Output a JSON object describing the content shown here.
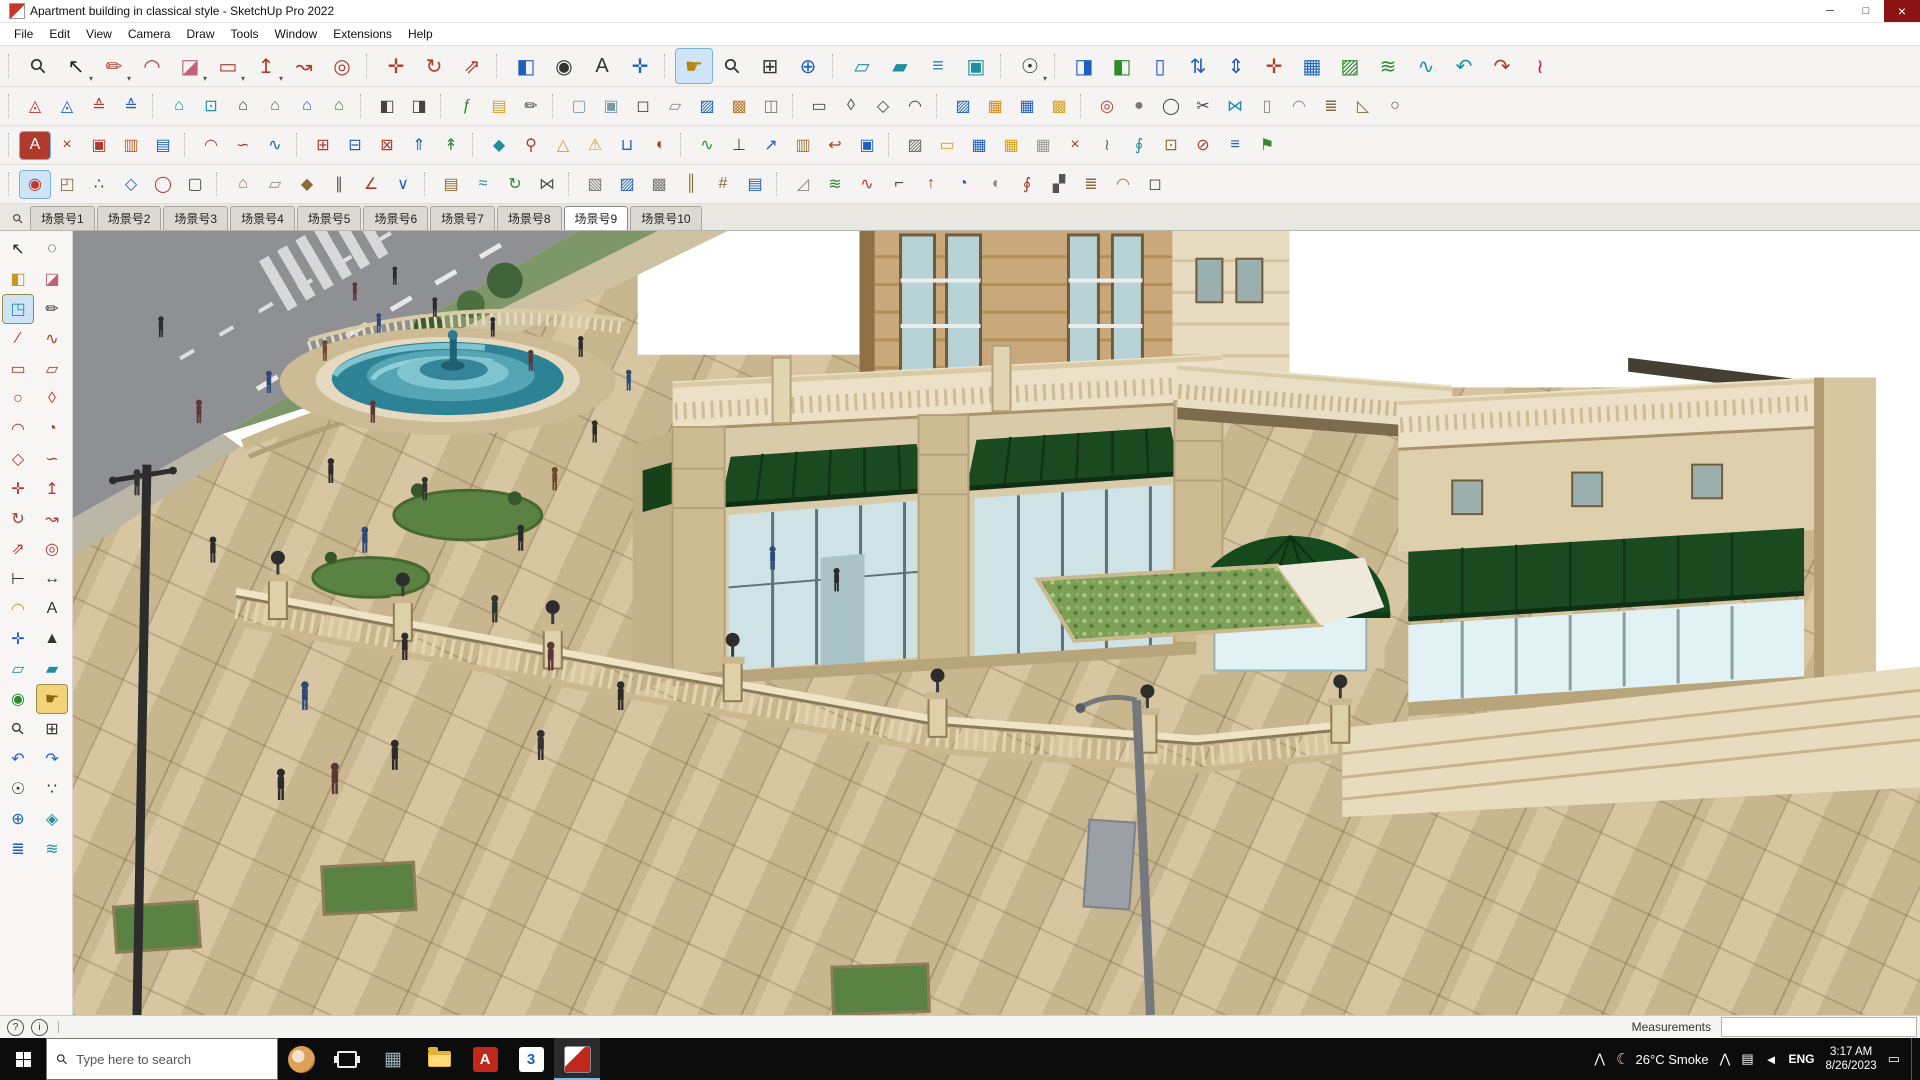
{
  "window": {
    "title": "Apartment building in classical style - SketchUp Pro 2022",
    "min_glyph": "─",
    "max_glyph": "□",
    "close_glyph": "×"
  },
  "ui": {
    "caret": "▾",
    "search_glyph": "⚲"
  },
  "menu": {
    "items": [
      "File",
      "Edit",
      "View",
      "Camera",
      "Draw",
      "Tools",
      "Window",
      "Extensions",
      "Help"
    ]
  },
  "toolbars": {
    "row1": [
      {
        "sep": true
      },
      {
        "n": "search-tool",
        "g": "⚲",
        "c": "#333",
        "rot": true
      },
      {
        "n": "select-tool",
        "g": "↖",
        "c": "#222",
        "dd": true
      },
      {
        "n": "line-tool",
        "g": "✏",
        "c": "#b03a2e",
        "dd": true
      },
      {
        "n": "arc-tool",
        "g": "◠",
        "c": "#b03a2e"
      },
      {
        "n": "eraser-tool",
        "g": "◪",
        "c": "#c0607a",
        "dd": true
      },
      {
        "n": "rectangle-tool",
        "g": "▭",
        "c": "#b03a2e",
        "dd": true
      },
      {
        "n": "push-pull-tool",
        "g": "↥",
        "c": "#b03a2e",
        "dd": true
      },
      {
        "n": "follow-me-tool",
        "g": "↝",
        "c": "#b03a2e"
      },
      {
        "n": "offset-tool",
        "g": "◎",
        "c": "#b03a2e"
      },
      {
        "sep": true
      },
      {
        "n": "move-tool",
        "g": "✛",
        "c": "#b03a2e"
      },
      {
        "n": "rotate-tool",
        "g": "↻",
        "c": "#b03a2e"
      },
      {
        "n": "scale-tool",
        "g": "⇗",
        "c": "#b03a2e"
      },
      {
        "sep": true
      },
      {
        "n": "paint-bucket-tool",
        "g": "◧",
        "c": "#1f5fbf"
      },
      {
        "n": "look-around-tool",
        "g": "◉",
        "c": "#333"
      },
      {
        "n": "text-tool",
        "g": "A",
        "c": "#333"
      },
      {
        "n": "axes-tool",
        "g": "✛",
        "c": "#1f5fbf"
      },
      {
        "sep": true
      },
      {
        "n": "pan-tool",
        "g": "☛",
        "c": "#b8860b",
        "hl": true
      },
      {
        "n": "zoom-tool",
        "g": "⚲",
        "c": "#333",
        "rot": true
      },
      {
        "n": "zoom-window-tool",
        "g": "⊞",
        "c": "#333"
      },
      {
        "n": "orbit-tool",
        "g": "⊕",
        "c": "#1f5fbf"
      },
      {
        "sep": true
      },
      {
        "n": "section-plane-tool",
        "g": "▱",
        "c": "#1f8fa0"
      },
      {
        "n": "section-fill-tool",
        "g": "▰",
        "c": "#1f8fa0"
      },
      {
        "n": "section-display-tool",
        "g": "≡",
        "c": "#1f8fa0"
      },
      {
        "n": "scene-manager-tool",
        "g": "▣",
        "c": "#1f8fa0"
      },
      {
        "sep": true
      },
      {
        "n": "camera-menu-tool",
        "g": "☉",
        "c": "#333",
        "dd": true
      },
      {
        "sep": true
      },
      {
        "n": "paint-all-tool",
        "g": "◨",
        "c": "#1f5fbf"
      },
      {
        "n": "sample-material-tool",
        "g": "◧",
        "c": "#2e8b2e"
      },
      {
        "n": "vertical-ruler-tool",
        "g": "▯",
        "c": "#1f5fbf"
      },
      {
        "n": "sort-ascending-tool",
        "g": "⇅",
        "c": "#1f5fbf"
      },
      {
        "n": "sort-descending-tool",
        "g": "⇕",
        "c": "#1f5fbf"
      },
      {
        "n": "cross-axes-tool",
        "g": "✛",
        "c": "#b03a2e"
      },
      {
        "n": "grid-tool",
        "g": "▦",
        "c": "#1f5fbf"
      },
      {
        "n": "uv-mapping-tool",
        "g": "▨",
        "c": "#2e8b2e"
      },
      {
        "n": "contour-tool",
        "g": "≋",
        "c": "#2e8b2e"
      },
      {
        "n": "weld-tool",
        "g": "∿",
        "c": "#1f8fa0"
      },
      {
        "n": "curve-undo-tool",
        "g": "↶",
        "c": "#1f8fa0"
      },
      {
        "n": "curve-redo-tool",
        "g": "↷",
        "c": "#b03a2e"
      },
      {
        "n": "curl-tool",
        "g": "≀",
        "c": "#c2185b"
      }
    ],
    "row2": [
      {
        "sep": true
      },
      {
        "n": "triangle-red-tool",
        "g": "◬",
        "c": "#b03a2e"
      },
      {
        "n": "triangle-blue-tool",
        "g": "◬",
        "c": "#1f5fbf"
      },
      {
        "n": "stack-red-tool",
        "g": "≙",
        "c": "#b03a2e"
      },
      {
        "n": "stack-blue-tool",
        "g": "≙",
        "c": "#1f5fbf"
      },
      {
        "sep": true
      },
      {
        "n": "iso-view",
        "g": "⌂",
        "c": "#1f8fa0"
      },
      {
        "n": "top-view",
        "g": "⊡",
        "c": "#1f8fa0"
      },
      {
        "n": "front-view",
        "g": "⌂",
        "c": "#444"
      },
      {
        "n": "back-view",
        "g": "⌂",
        "c": "#666"
      },
      {
        "n": "left-view",
        "g": "⌂",
        "c": "#1f5fbf"
      },
      {
        "n": "right-view",
        "g": "⌂",
        "c": "#2e8b2e"
      },
      {
        "sep": true
      },
      {
        "n": "perspective-toggle",
        "g": "◧",
        "c": "#444"
      },
      {
        "n": "two-point-perspective",
        "g": "◨",
        "c": "#444"
      },
      {
        "sep": true
      },
      {
        "n": "fredo-tools",
        "g": "ƒ",
        "c": "#2e8b2e"
      },
      {
        "n": "note-tool",
        "g": "▤",
        "c": "#d9a21a"
      },
      {
        "n": "sketch-pencil",
        "g": "✏",
        "c": "#444"
      },
      {
        "sep": true
      },
      {
        "n": "xray-mode",
        "g": "▢",
        "c": "#7a9aa8"
      },
      {
        "n": "back-edges-mode",
        "g": "▣",
        "c": "#7a9aa8"
      },
      {
        "n": "wireframe-mode",
        "g": "◻",
        "c": "#444"
      },
      {
        "n": "hidden-line-mode",
        "g": "▱",
        "c": "#888"
      },
      {
        "n": "shaded-mode",
        "g": "▨",
        "c": "#1f5fbf"
      },
      {
        "n": "textured-mode",
        "g": "▩",
        "c": "#b9792e"
      },
      {
        "n": "monochrome-mode",
        "g": "◫",
        "c": "#777"
      },
      {
        "sep": true
      },
      {
        "n": "shape-rectangle",
        "g": "▭",
        "c": "#444"
      },
      {
        "n": "shape-ellipse",
        "g": "◊",
        "c": "#444"
      },
      {
        "n": "shape-polygon",
        "g": "◇",
        "c": "#444"
      },
      {
        "n": "shape-arc",
        "g": "◠",
        "c": "#444"
      },
      {
        "sep": true
      },
      {
        "n": "hatch-fill-tool",
        "g": "▨",
        "c": "#1f5fbf"
      },
      {
        "n": "grid-orange-tool",
        "g": "▦",
        "c": "#e08a1e"
      },
      {
        "n": "grid-blue-tool",
        "g": "▦",
        "c": "#1f5fbf"
      },
      {
        "n": "lattice-tool",
        "g": "▩",
        "c": "#d9a21a"
      },
      {
        "sep": true
      },
      {
        "n": "target-point-tool",
        "g": "◎",
        "c": "#b03a2e"
      },
      {
        "n": "sphere-tool",
        "g": "●",
        "c": "#777"
      },
      {
        "n": "ring-tool",
        "g": "◯",
        "c": "#444"
      },
      {
        "n": "scissors-tool",
        "g": "✂",
        "c": "#444"
      },
      {
        "n": "mirror-tool",
        "g": "⋈",
        "c": "#1f8fa0"
      },
      {
        "n": "cylinder-tool",
        "g": "▯",
        "c": "#888"
      },
      {
        "n": "dome-tool",
        "g": "◠",
        "c": "#888"
      },
      {
        "n": "stairs-tool",
        "g": "≣",
        "c": "#8a6d3b"
      },
      {
        "n": "ramp-tool",
        "g": "◺",
        "c": "#8a6d3b"
      },
      {
        "n": "pipe-tool",
        "g": "○",
        "c": "#555"
      }
    ],
    "row3": [
      {
        "sep": true
      },
      {
        "n": "artisan-badge",
        "g": "A",
        "c": "#fff",
        "b": "#b03a2e"
      },
      {
        "n": "close-palette-icon",
        "g": "×",
        "c": "#b03a2e"
      },
      {
        "n": "red-material-tool",
        "g": "▣",
        "c": "#b03a2e"
      },
      {
        "n": "color-palette-tool",
        "g": "▥",
        "c": "#c0632e"
      },
      {
        "n": "swatch-blue-tool",
        "g": "▤",
        "c": "#1f5fbf"
      },
      {
        "sep": true
      },
      {
        "n": "arc-plugin-tool",
        "g": "◠",
        "c": "#b03a2e"
      },
      {
        "n": "bezier-curve-tool",
        "g": "∽",
        "c": "#b03a2e"
      },
      {
        "n": "spline-tool",
        "g": "∿",
        "c": "#1f5fbf"
      },
      {
        "sep": true
      },
      {
        "n": "joint-push-pull",
        "g": "⊞",
        "c": "#b03a2e"
      },
      {
        "n": "vector-push-pull",
        "g": "⊟",
        "c": "#1f5fbf"
      },
      {
        "n": "normal-push-pull",
        "g": "⊠",
        "c": "#b03a2e"
      },
      {
        "n": "extrude-up-tool",
        "g": "⇑",
        "c": "#1f5fbf"
      },
      {
        "n": "extrude-normal-tool",
        "g": "↟",
        "c": "#2e8b2e"
      },
      {
        "sep": true
      },
      {
        "n": "drop-vertices-tool",
        "g": "◆",
        "c": "#1f8fa0"
      },
      {
        "n": "pin-tool",
        "g": "⚲",
        "c": "#b03a2e"
      },
      {
        "n": "cone-tool",
        "g": "△",
        "c": "#d9a21a"
      },
      {
        "n": "fix-problems-tool",
        "g": "⚠",
        "c": "#d9a21a"
      },
      {
        "n": "u-profile-tool",
        "g": "⊔",
        "c": "#1f5fbf"
      },
      {
        "n": "round-corner-tool",
        "g": "◖",
        "c": "#b03a2e"
      },
      {
        "sep": true
      },
      {
        "n": "wave-curve-tool",
        "g": "∿",
        "c": "#2e8b2e"
      },
      {
        "n": "perpendicular-tool",
        "g": "⊥",
        "c": "#444"
      },
      {
        "n": "arrow-ne-tool",
        "g": "↗",
        "c": "#1f5fbf"
      },
      {
        "n": "crate-box-tool",
        "g": "▥",
        "c": "#a5773f"
      },
      {
        "n": "revert-arrow-tool",
        "g": "↩",
        "c": "#b03a2e"
      },
      {
        "n": "component-tool",
        "g": "▣",
        "c": "#1f5fbf"
      },
      {
        "sep": true
      },
      {
        "n": "hatch-gray-tool",
        "g": "▨",
        "c": "#666"
      },
      {
        "n": "ruler-tool",
        "g": "▭",
        "c": "#d9a21a"
      },
      {
        "n": "grid-small-blue",
        "g": "▦",
        "c": "#1f5fbf"
      },
      {
        "n": "grid-small-yellow",
        "g": "▦",
        "c": "#d9a21a"
      },
      {
        "n": "grid-small-gray",
        "g": "▦",
        "c": "#999"
      },
      {
        "n": "delete-x-tool",
        "g": "×",
        "c": "#b03a2e"
      },
      {
        "n": "zigzag-tool",
        "g": "≀",
        "c": "#666"
      },
      {
        "n": "loop-tool",
        "g": "∮",
        "c": "#1f8fa0"
      },
      {
        "n": "nested-boxes-tool",
        "g": "⊡",
        "c": "#8a6d3b"
      },
      {
        "n": "slice-tool",
        "g": "⊘",
        "c": "#b03a2e"
      },
      {
        "n": "layer-stack-tool",
        "g": "≡",
        "c": "#1f5fbf"
      },
      {
        "n": "flag-tool",
        "g": "⚑",
        "c": "#2e8b2e"
      }
    ],
    "row4": [
      {
        "sep": true
      },
      {
        "n": "red-target-tool",
        "g": "◉",
        "c": "#c0392b",
        "b": "#cfe4f7"
      },
      {
        "n": "cube-tool",
        "g": "◰",
        "c": "#8a6d3b"
      },
      {
        "n": "dots-array-tool",
        "g": "∴",
        "c": "#444"
      },
      {
        "n": "hex-tool",
        "g": "◇",
        "c": "#1f5fbf"
      },
      {
        "n": "circle-plugin-tool",
        "g": "◯",
        "c": "#b03a2e"
      },
      {
        "n": "box-plugin-tool",
        "g": "▢",
        "c": "#444"
      },
      {
        "sep": true
      },
      {
        "n": "roof-tool",
        "g": "⌂",
        "c": "#a5773f"
      },
      {
        "n": "plane-tool",
        "g": "▱",
        "c": "#888"
      },
      {
        "n": "prism-tool",
        "g": "◆",
        "c": "#8a6d3b"
      },
      {
        "n": "pipes-parallel-tool",
        "g": "∥",
        "c": "#555"
      },
      {
        "n": "angle-tool",
        "g": "∠",
        "c": "#b03a2e"
      },
      {
        "n": "vee-tool",
        "g": "∨",
        "c": "#1f5fbf"
      },
      {
        "sep": true
      },
      {
        "n": "stair-maker-tool",
        "g": "▤",
        "c": "#8a6d3b"
      },
      {
        "n": "terrain-wave-tool",
        "g": "≈",
        "c": "#1f8fa0"
      },
      {
        "n": "loop-arrow-tool",
        "g": "↻",
        "c": "#2e8b2e"
      },
      {
        "n": "mirror-plugin-tool",
        "g": "⋈",
        "c": "#555"
      },
      {
        "sep": true
      },
      {
        "n": "hatch-light-tool",
        "g": "▧",
        "c": "#777"
      },
      {
        "n": "hatch-blue-tool",
        "g": "▨",
        "c": "#1f5fbf"
      },
      {
        "n": "hatch-dense-tool",
        "g": "▩",
        "c": "#777"
      },
      {
        "n": "column-tool",
        "g": "║",
        "c": "#8a6d3b"
      },
      {
        "n": "fence-tool",
        "g": "#",
        "c": "#8a6d3b"
      },
      {
        "n": "screen-panel-tool",
        "g": "▤",
        "c": "#1f5fbf"
      },
      {
        "sep": true
      },
      {
        "n": "slope-tool",
        "g": "◿",
        "c": "#888"
      },
      {
        "n": "terrain-tool",
        "g": "≋",
        "c": "#2e8b2e"
      },
      {
        "n": "path-curve-tool",
        "g": "∿",
        "c": "#b03a2e"
      },
      {
        "n": "profile-corner-tool",
        "g": "⌐",
        "c": "#444"
      },
      {
        "n": "extrude-arrow-tool",
        "g": "↑",
        "c": "#b03a2e"
      },
      {
        "n": "lathe-tool",
        "g": "◔",
        "c": "#1f5fbf"
      },
      {
        "n": "shell-tool",
        "g": "◖",
        "c": "#888"
      },
      {
        "n": "twist-tool",
        "g": "∮",
        "c": "#b03a2e"
      },
      {
        "n": "array-tool",
        "g": "▞",
        "c": "#555"
      },
      {
        "n": "rail-tool",
        "g": "≣",
        "c": "#8a6d3b"
      },
      {
        "n": "arch-tool",
        "g": "◠",
        "c": "#a5773f"
      },
      {
        "n": "frame-tool",
        "g": "◻",
        "c": "#444"
      }
    ]
  },
  "sidebar": {
    "tools": [
      {
        "n": "select-tool",
        "g": "↖",
        "c": "#222"
      },
      {
        "n": "lasso-tool",
        "g": "◌",
        "c": "#222"
      },
      {
        "n": "paint-bucket-tool",
        "g": "◧",
        "c": "#c9942a"
      },
      {
        "n": "eraser-tool",
        "g": "◪",
        "c": "#c0607a"
      },
      {
        "n": "push-pull-cube-tool",
        "g": "◳",
        "c": "#1f8fa0",
        "b": "#cfe4f7"
      },
      {
        "n": "pencil-tool",
        "g": "✏",
        "c": "#333"
      },
      {
        "n": "line-tool",
        "g": "∕",
        "c": "#b03a2e"
      },
      {
        "n": "freehand-tool",
        "g": "∿",
        "c": "#b03a2e"
      },
      {
        "n": "rectangle-tool",
        "g": "▭",
        "c": "#b03a2e"
      },
      {
        "n": "rotated-rectangle-tool",
        "g": "▱",
        "c": "#b03a2e"
      },
      {
        "n": "circle-tool",
        "g": "○",
        "c": "#b03a2e"
      },
      {
        "n": "ellipse-tool",
        "g": "◊",
        "c": "#b03a2e"
      },
      {
        "n": "arc-tool",
        "g": "◠",
        "c": "#b03a2e"
      },
      {
        "n": "pie-tool",
        "g": "◔",
        "c": "#b03a2e"
      },
      {
        "n": "polygon-tool",
        "g": "◇",
        "c": "#b03a2e"
      },
      {
        "n": "bezier-tool",
        "g": "∽",
        "c": "#b03a2e"
      },
      {
        "n": "move-tool",
        "g": "✛",
        "c": "#b03a2e"
      },
      {
        "n": "push-pull-tool",
        "g": "↥",
        "c": "#b03a2e"
      },
      {
        "n": "rotate-tool",
        "g": "↻",
        "c": "#b03a2e"
      },
      {
        "n": "follow-me-tool",
        "g": "↝",
        "c": "#b03a2e"
      },
      {
        "n": "scale-tool",
        "g": "⇗",
        "c": "#b03a2e"
      },
      {
        "n": "offset-tool",
        "g": "◎",
        "c": "#b03a2e"
      },
      {
        "n": "tape-measure-tool",
        "g": "⊢",
        "c": "#333"
      },
      {
        "n": "dimension-tool",
        "g": "↔",
        "c": "#333"
      },
      {
        "n": "protractor-tool",
        "g": "◠",
        "c": "#c9942a"
      },
      {
        "n": "text-tool",
        "g": "A",
        "c": "#333"
      },
      {
        "n": "axes-tool",
        "g": "✛",
        "c": "#1f5fbf"
      },
      {
        "n": "3d-text-tool",
        "g": "▲",
        "c": "#333"
      },
      {
        "n": "section-plane-tool",
        "g": "▱",
        "c": "#1f8fa0"
      },
      {
        "n": "section-fill-tool",
        "g": "▰",
        "c": "#1f8fa0"
      },
      {
        "n": "look-around-tool",
        "g": "◉",
        "c": "#2e8b2e"
      },
      {
        "n": "pan-tool",
        "g": "☛",
        "c": "#8a6508",
        "b": "#f3d37a"
      },
      {
        "n": "zoom-tool",
        "g": "⚲",
        "c": "#333",
        "rot": true
      },
      {
        "n": "zoom-window-tool",
        "g": "⊞",
        "c": "#333"
      },
      {
        "n": "previous-view-tool",
        "g": "↶",
        "c": "#1f5fbf"
      },
      {
        "n": "next-view-tool",
        "g": "↷",
        "c": "#1f5fbf"
      },
      {
        "n": "position-camera-tool",
        "g": "☉",
        "c": "#333"
      },
      {
        "n": "walk-tool",
        "g": "∵",
        "c": "#333"
      },
      {
        "n": "geo-location-tool",
        "g": "⊕",
        "c": "#1f5fbf"
      },
      {
        "n": "match-photo-tool",
        "g": "◈",
        "c": "#1f8fa0"
      },
      {
        "n": "layers-panel-tool",
        "g": "≣",
        "c": "#1f5fbf"
      },
      {
        "n": "fog-style-tool",
        "g": "≋",
        "c": "#1f8fa0"
      }
    ]
  },
  "scene_tabs": {
    "items": [
      "场景号1",
      "场景号2",
      "场景号3",
      "场景号4",
      "场景号5",
      "场景号6",
      "场景号7",
      "场景号8",
      "场景号9",
      "场景号10"
    ],
    "active_index": 8
  },
  "statusbar": {
    "help_glyph": "?",
    "info_glyph": "i",
    "measurements_label": "Measurements",
    "measurements_value": ""
  },
  "taskbar": {
    "search_placeholder": "Type here to search",
    "app_grid_glyph": "▦",
    "acrobat_letter": "A",
    "app3_label": "3",
    "tray": {
      "chevron_glyph": "⋀",
      "weather_glyph": "☾",
      "weather_text": "26°C Smoke",
      "network_glyph": "▤",
      "volume_glyph": "◄",
      "language": "ENG",
      "time": "3:17 AM",
      "date": "8/26/2023",
      "notification_glyph": "▭"
    }
  }
}
